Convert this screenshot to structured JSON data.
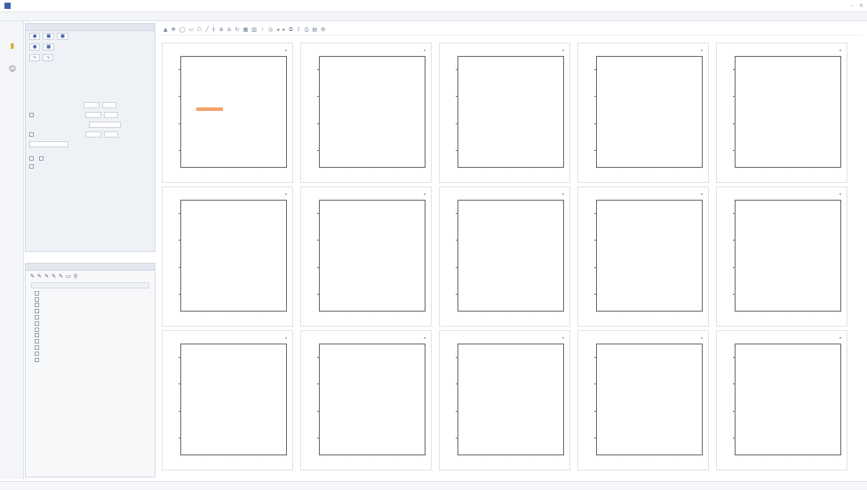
{
  "window": {
    "title": "",
    "controls": [
      "–",
      "×"
    ]
  },
  "menu": [
    "",
    "",
    "",
    "",
    "",
    "",
    "",
    ""
  ],
  "properties_panel": {
    "header": "",
    "buttons_row1": [
      {
        "icon": "circle-icon"
      },
      {
        "icon": "square-icon"
      },
      {
        "icon": "square-icon"
      }
    ],
    "buttons_row2": [
      {
        "icon": "circle-icon"
      },
      {
        "icon": "square-icon"
      }
    ],
    "buttons_row3": [
      {
        "icon": "curve-icon"
      },
      {
        "icon": "curve-icon"
      }
    ],
    "kv": [
      {
        "k": "",
        "v": ""
      },
      {
        "k": "",
        "v": ""
      },
      {
        "k": "",
        "v": ""
      },
      {
        "k": "",
        "v": ""
      }
    ],
    "fields": [
      "",
      "",
      "",
      "",
      ""
    ],
    "options": [
      "",
      "",
      ""
    ]
  },
  "tree_panel": {
    "header": "",
    "columns": [
      "",
      "",
      ""
    ],
    "items": [
      "",
      "",
      "",
      "",
      "",
      "",
      "",
      "",
      "",
      "",
      "",
      ""
    ]
  },
  "plots": [
    {
      "title": "",
      "xlabel": "",
      "ylabel": ""
    },
    {
      "title": "",
      "xlabel": "",
      "ylabel": ""
    },
    {
      "title": "",
      "xlabel": "",
      "ylabel": ""
    },
    {
      "title": "",
      "xlabel": "",
      "ylabel": ""
    },
    {
      "title": "",
      "xlabel": "",
      "ylabel": ""
    },
    {
      "title": "",
      "xlabel": "",
      "ylabel": ""
    },
    {
      "title": "",
      "xlabel": "",
      "ylabel": ""
    },
    {
      "title": "",
      "xlabel": "",
      "ylabel": ""
    },
    {
      "title": "",
      "xlabel": "",
      "ylabel": ""
    },
    {
      "title": "",
      "xlabel": "",
      "ylabel": ""
    },
    {
      "title": "",
      "xlabel": "",
      "ylabel": ""
    },
    {
      "title": "",
      "xlabel": "",
      "ylabel": ""
    },
    {
      "title": "",
      "xlabel": "",
      "ylabel": ""
    },
    {
      "title": "",
      "xlabel": "",
      "ylabel": ""
    },
    {
      "title": "",
      "xlabel": "",
      "ylabel": ""
    }
  ],
  "status": {
    "left": [
      "",
      "",
      ""
    ],
    "right": [
      "",
      "",
      ""
    ]
  },
  "colors": {
    "accent": "#3f5fa8",
    "gate": "#ff8a3c"
  }
}
